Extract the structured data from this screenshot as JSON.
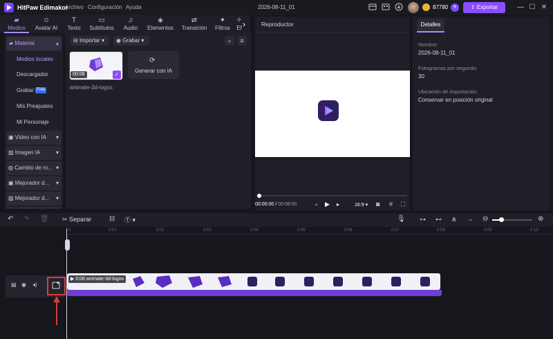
{
  "titlebar": {
    "app_name": "HitPaw Edimakor",
    "menu": [
      "Archivo",
      "Configuración",
      "Ayuda"
    ],
    "project_name": "2026-08-11_01",
    "credits": "87780",
    "export_label": "Exportar"
  },
  "tabs": [
    {
      "label": "Medios",
      "icon": "folder-icon"
    },
    {
      "label": "Avatar AI",
      "icon": "avatar-icon"
    },
    {
      "label": "Texto",
      "icon": "text-icon"
    },
    {
      "label": "Subtítulos",
      "icon": "subtitle-icon"
    },
    {
      "label": "Audio",
      "icon": "music-icon"
    },
    {
      "label": "Elementos",
      "icon": "shapes-icon"
    },
    {
      "label": "Transición",
      "icon": "transition-icon"
    },
    {
      "label": "Filtros",
      "icon": "filter-icon"
    },
    {
      "label": "Ef",
      "icon": "effect-icon"
    }
  ],
  "sidebar": {
    "section": "Material",
    "subitems": [
      "Medios locales",
      "Descargador",
      "Grabar",
      "Mis Preajustes",
      "Mi Personaje"
    ],
    "badge": "Free",
    "groups": [
      "Video con IA",
      "Imagen IA",
      "Cambio de ro...",
      "Mejorador d...",
      "Mejorador d..."
    ]
  },
  "media": {
    "import_label": "Importar",
    "record_label": "Grabar",
    "item_duration": "00:08",
    "item_name": "animate-3d-logos",
    "generate_label": "Generar con IA"
  },
  "player": {
    "title": "Reproductor",
    "time_current": "00:00:00",
    "time_total": "00:08:00",
    "aspect": "16:9"
  },
  "details": {
    "tab": "Detalles",
    "fields": [
      {
        "label": "Nombre:",
        "value": "2026-08-11_01"
      },
      {
        "label": "Fotogramas por segundo:",
        "value": "30"
      },
      {
        "label": "Ubicación de importación:",
        "value": "Conservar en posición original"
      }
    ]
  },
  "timeline": {
    "split_label": "Separar",
    "ruler": [
      "0",
      "0:01",
      "0:02",
      "0:03",
      "0:04",
      "0:05",
      "0:06",
      "0:07",
      "0:08",
      "0:09",
      "0:10"
    ],
    "clip_label": "0:08 animate-3d-logos"
  },
  "colors": {
    "accent": "#8c4cff",
    "active_tab": "#a98bff",
    "track": "#6e3fd6",
    "highlight": "#e03a3a"
  }
}
